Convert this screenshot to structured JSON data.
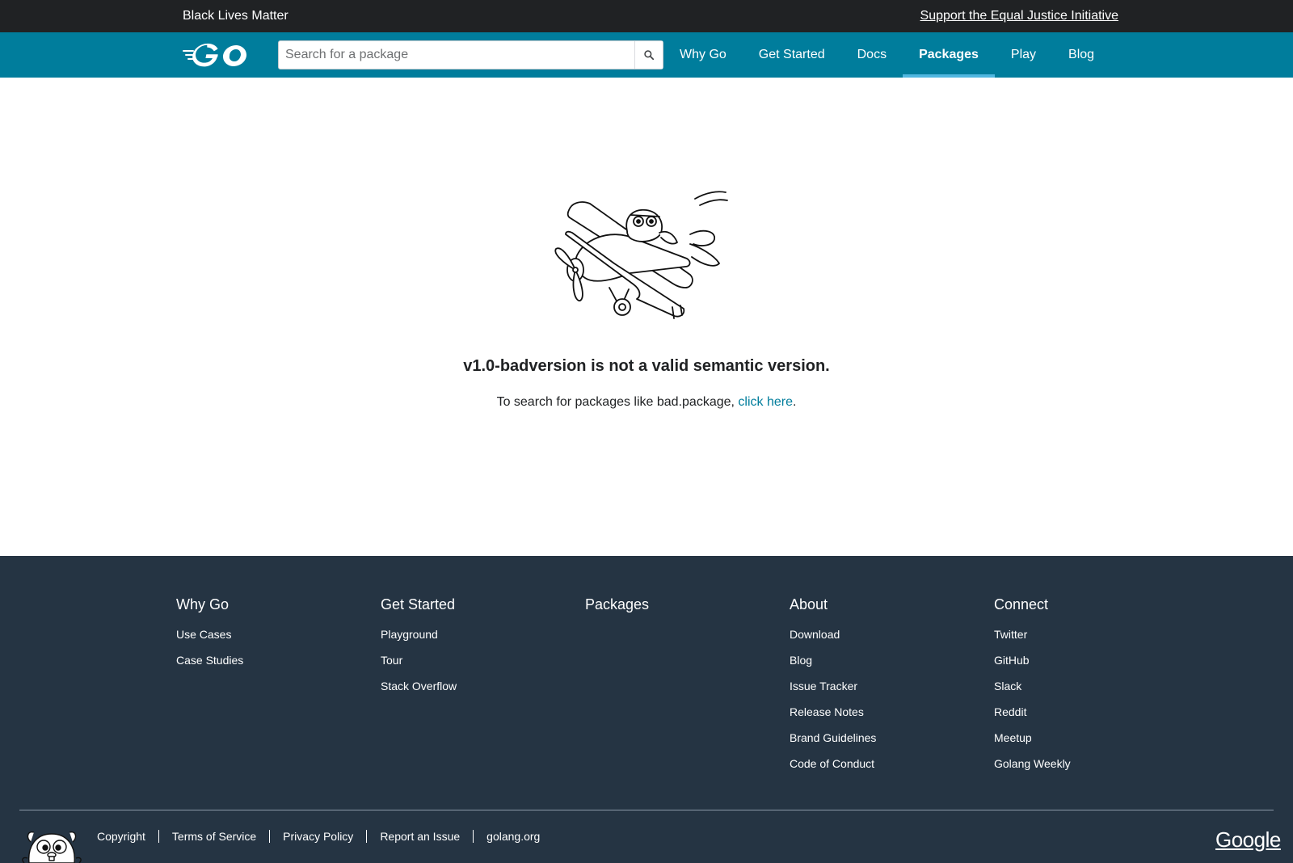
{
  "banner": {
    "text": "Black Lives Matter",
    "link": "Support the Equal Justice Initiative"
  },
  "header": {
    "logo_alt": "Go",
    "search": {
      "placeholder": "Search for a package",
      "value": ""
    },
    "nav": [
      {
        "label": "Why Go",
        "active": false
      },
      {
        "label": "Get Started",
        "active": false
      },
      {
        "label": "Docs",
        "active": false
      },
      {
        "label": "Packages",
        "active": true
      },
      {
        "label": "Play",
        "active": false
      },
      {
        "label": "Blog",
        "active": false
      }
    ]
  },
  "main": {
    "title": "v1.0-badversion is not a valid semantic version.",
    "sub_prefix": "To search for packages like bad.package, ",
    "sub_link": "click here",
    "sub_suffix": "."
  },
  "footer": {
    "columns": [
      {
        "heading": "Why Go",
        "links": [
          "Use Cases",
          "Case Studies"
        ]
      },
      {
        "heading": "Get Started",
        "links": [
          "Playground",
          "Tour",
          "Stack Overflow"
        ]
      },
      {
        "heading": "Packages",
        "links": []
      },
      {
        "heading": "About",
        "links": [
          "Download",
          "Blog",
          "Issue Tracker",
          "Release Notes",
          "Brand Guidelines",
          "Code of Conduct"
        ]
      },
      {
        "heading": "Connect",
        "links": [
          "Twitter",
          "GitHub",
          "Slack",
          "Reddit",
          "Meetup",
          "Golang Weekly"
        ]
      }
    ],
    "bottom_links": [
      "Copyright",
      "Terms of Service",
      "Privacy Policy",
      "Report an Issue",
      "golang.org"
    ],
    "google": "Google"
  },
  "colors": {
    "banner_bg": "#202224",
    "header_bg": "#007d9c",
    "active_underline": "#50b7e0",
    "footer_bg": "#253443",
    "link": "#007d9c"
  }
}
